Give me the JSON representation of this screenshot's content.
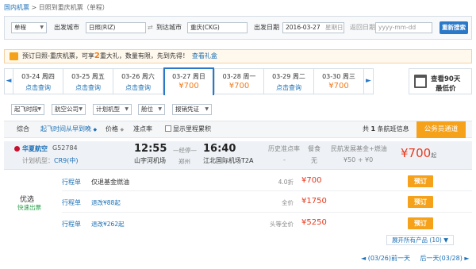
{
  "breadcrumb": {
    "home": "国内机票",
    "sep": ">",
    "current": "日照到重庆机票（单程）"
  },
  "search": {
    "trip_type": "单程",
    "from_label": "出发城市",
    "from_value": "日照(RIZ)",
    "swap_label": "⇄",
    "to_label": "到达城市",
    "to_value": "重庆(CKG)",
    "depart_label": "出发日期",
    "depart_value": "2016-03-27",
    "depart_weekday": "星期日",
    "return_label": "返回日期",
    "return_placeholder": "yyyy-mm-dd",
    "search_button": "重新搜索"
  },
  "promo": {
    "text_a": "预订日照-重庆机票，可享",
    "num": "2",
    "text_b": "重大礼，数量有限，先到先得！",
    "link": "查看礼盒"
  },
  "dates": [
    {
      "date": "03-24 周四",
      "price": "点击查询",
      "is_price": false
    },
    {
      "date": "03-25 周五",
      "price": "点击查询",
      "is_price": false
    },
    {
      "date": "03-26 周六",
      "price": "点击查询",
      "is_price": false
    },
    {
      "date": "03-27 周日",
      "price": "¥700",
      "is_price": true,
      "active": true
    },
    {
      "date": "03-28 周一",
      "price": "¥700",
      "is_price": true
    },
    {
      "date": "03-29 周二",
      "price": "点击查询",
      "is_price": false
    },
    {
      "date": "03-30 周三",
      "price": "¥700",
      "is_price": true
    }
  ],
  "cal90": {
    "line1": "查看90天",
    "line2": "最低价"
  },
  "filters": [
    "起飞时段",
    "航空公司",
    "计划机型",
    "舱位",
    "报销凭证"
  ],
  "sortbar": {
    "overall": "综合",
    "depart_sort": "起飞时间从早到晚",
    "depart_arrow": "◆",
    "price": "价格",
    "price_arrow": "◆",
    "ontime": "准点率",
    "show_miles": "显示里程累积",
    "count_a": "共",
    "count_num": "1",
    "count_b": "条航班信息",
    "gov_button": "公务员通道"
  },
  "flight": {
    "airline": "华夏航空",
    "flight_no": "G52784",
    "plan_label": "计划机型：",
    "plan_value": "CR9(中)",
    "dep_time": "12:55",
    "dep_airport": "山字河机场",
    "stop_label": "经停",
    "stop_city": "郑州",
    "arr_time": "16:40",
    "arr_airport": "江北国际机场T2A",
    "ontime_label": "历史准点率",
    "ontime_value": "-",
    "meal_label": "餐食",
    "meal_value": "无",
    "tax_label": "民航发展基金+燃油",
    "tax_value": "¥50 + ¥0",
    "lowest_price": "¥700",
    "lowest_suffix": "起"
  },
  "youxuan": {
    "title": "优选",
    "sub": "快速出票"
  },
  "cabins": [
    {
      "type": "行程单",
      "desc": "仅退基金燃油",
      "desc_blue": "",
      "disc": "4.0折",
      "price": "¥700",
      "book": "预订"
    },
    {
      "type": "行程单",
      "desc": "",
      "desc_blue": "退改¥88起",
      "disc": "全价",
      "price": "¥1750",
      "book": "预订"
    },
    {
      "type": "行程单",
      "desc": "",
      "desc_blue": "退改¥262起",
      "disc": "头等全价",
      "price": "¥5250",
      "book": "预订"
    }
  ],
  "showall": "展开所有产品 (10) ▼",
  "pager": {
    "prev": "◄ (03/26)前一天",
    "next": "后一天(03/28) ►"
  }
}
